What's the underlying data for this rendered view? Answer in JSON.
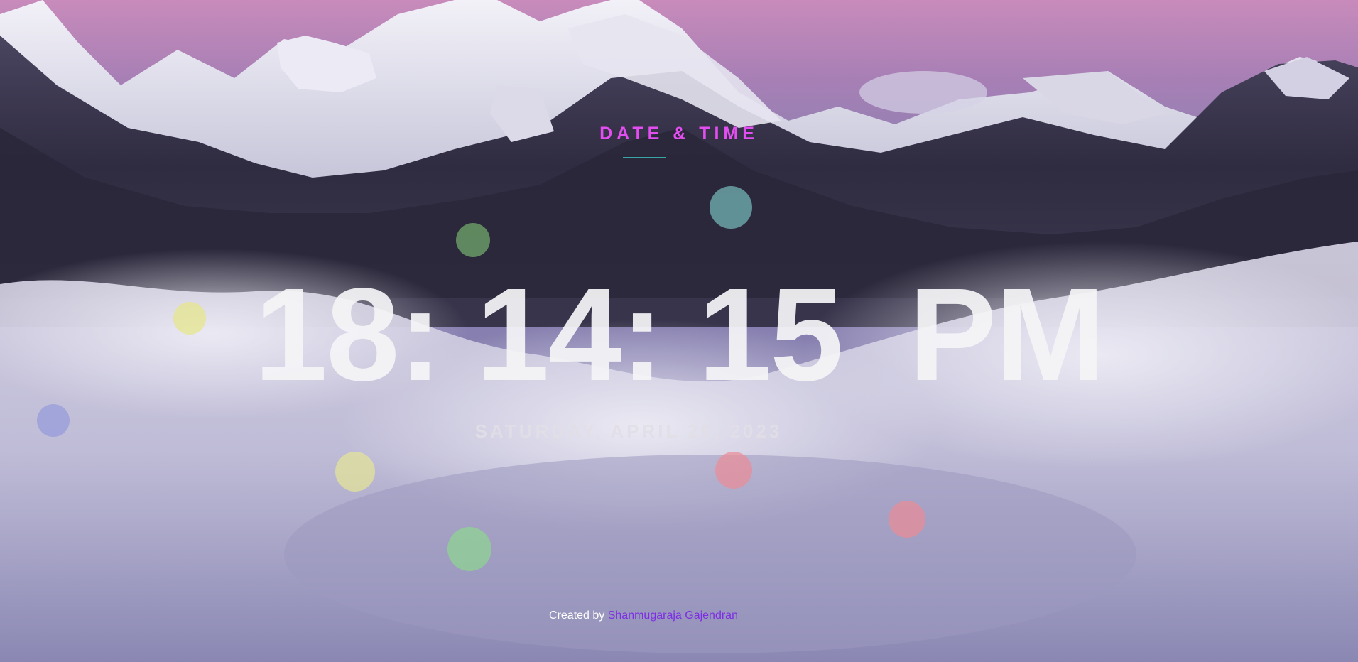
{
  "header": {
    "title": "DATE & TIME"
  },
  "clock": {
    "hours": "18",
    "minutes": "14",
    "seconds": "15",
    "separator": ":",
    "period": "PM"
  },
  "date": {
    "text": "SATURDAY, APRIL 29, 2023"
  },
  "footer": {
    "prefix": "Created by",
    "author": "Shanmugaraja Gajendran"
  },
  "colors": {
    "heading": "#e34ef0",
    "accent_rule": "#39a6a6",
    "author_link": "#7d2de3",
    "sky_top": "#c98fbf",
    "cloud": "#d8d6e6"
  },
  "bubbles": [
    {
      "color": "teal"
    },
    {
      "color": "green"
    },
    {
      "color": "yellow"
    },
    {
      "color": "blue"
    },
    {
      "color": "yellow"
    },
    {
      "color": "red"
    },
    {
      "color": "red"
    },
    {
      "color": "green"
    }
  ]
}
